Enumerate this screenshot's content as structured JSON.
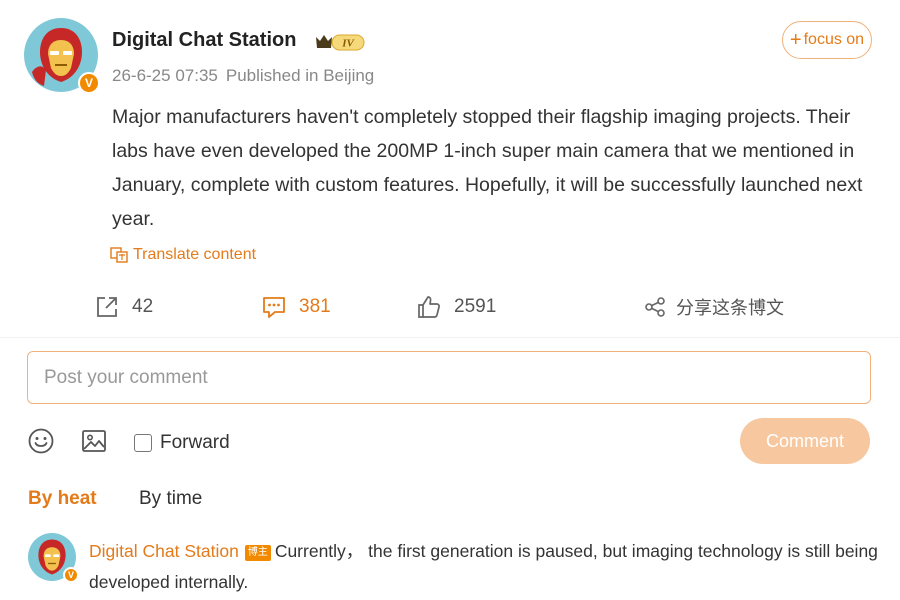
{
  "post": {
    "author": "Digital Chat Station",
    "level_badge": "IV",
    "verified_badge": "V",
    "date": "26-6-25 07:35",
    "location": "Published in Beijing",
    "focus_label": "focus on",
    "focus_plus": "+",
    "body": "Major manufacturers haven't completely stopped their flagship imaging projects. Their labs have even developed the 200MP 1-inch super main camera that we mentioned in January, complete with custom features. Hopefully, it will be successfully launched next year.",
    "translate_label": "Translate content"
  },
  "actions": {
    "repost_count": "42",
    "comment_count": "381",
    "like_count": "2591",
    "share_label": "分享这条博文"
  },
  "composer": {
    "placeholder": "Post your comment",
    "forward_label": "Forward",
    "submit_label": "Comment"
  },
  "sort": {
    "by_heat": "By heat",
    "by_time": "By time"
  },
  "top_comment": {
    "author": "Digital Chat Station",
    "tag": "博主",
    "text": "Currently， the first generation is paused, but imaging technology is still being developed internally."
  },
  "colors": {
    "accent": "#e37b1a",
    "accent_light": "#f0b27a",
    "button_disabled": "#f7c8a0"
  },
  "icons": [
    "repost-icon",
    "comment-icon",
    "like-icon",
    "share-icon",
    "emoji-icon",
    "image-icon",
    "translate-icon",
    "crown-icon"
  ]
}
